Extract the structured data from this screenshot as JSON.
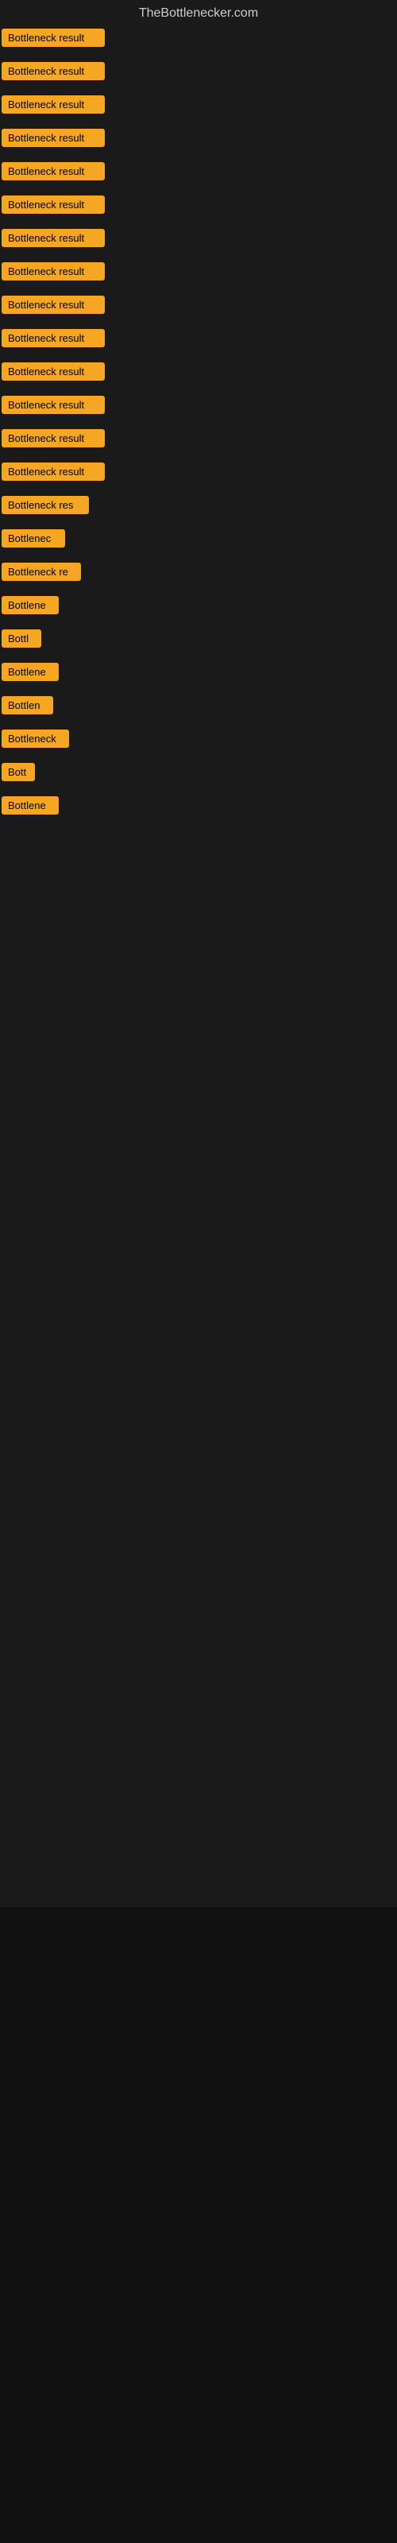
{
  "site": {
    "title": "TheBottlenecker.com"
  },
  "badge_label": "Bottleneck result",
  "items": [
    {
      "id": 1,
      "label": "Bottleneck result",
      "width": 130
    },
    {
      "id": 2,
      "label": "Bottleneck result",
      "width": 130
    },
    {
      "id": 3,
      "label": "Bottleneck result",
      "width": 130
    },
    {
      "id": 4,
      "label": "Bottleneck result",
      "width": 130
    },
    {
      "id": 5,
      "label": "Bottleneck result",
      "width": 130
    },
    {
      "id": 6,
      "label": "Bottleneck result",
      "width": 130
    },
    {
      "id": 7,
      "label": "Bottleneck result",
      "width": 130
    },
    {
      "id": 8,
      "label": "Bottleneck result",
      "width": 130
    },
    {
      "id": 9,
      "label": "Bottleneck result",
      "width": 130
    },
    {
      "id": 10,
      "label": "Bottleneck result",
      "width": 130
    },
    {
      "id": 11,
      "label": "Bottleneck result",
      "width": 130
    },
    {
      "id": 12,
      "label": "Bottleneck result",
      "width": 130
    },
    {
      "id": 13,
      "label": "Bottleneck result",
      "width": 130
    },
    {
      "id": 14,
      "label": "Bottleneck result",
      "width": 130
    },
    {
      "id": 15,
      "label": "Bottleneck res",
      "width": 110
    },
    {
      "id": 16,
      "label": "Bottlenec",
      "width": 80
    },
    {
      "id": 17,
      "label": "Bottleneck re",
      "width": 100
    },
    {
      "id": 18,
      "label": "Bottlene",
      "width": 72
    },
    {
      "id": 19,
      "label": "Bottl",
      "width": 50
    },
    {
      "id": 20,
      "label": "Bottlene",
      "width": 72
    },
    {
      "id": 21,
      "label": "Bottlen",
      "width": 65
    },
    {
      "id": 22,
      "label": "Bottleneck",
      "width": 85
    },
    {
      "id": 23,
      "label": "Bott",
      "width": 42
    },
    {
      "id": 24,
      "label": "Bottlene",
      "width": 72
    }
  ],
  "small_label": "1",
  "colors": {
    "badge_bg": "#f5a623",
    "badge_text": "#000000",
    "background": "#1a1a1a",
    "title_text": "#cccccc"
  }
}
